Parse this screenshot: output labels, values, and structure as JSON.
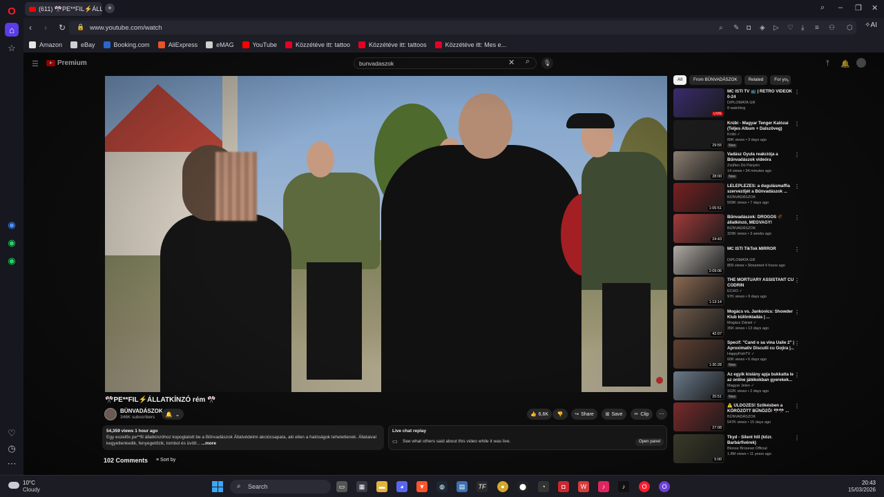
{
  "browser": {
    "tab_title": "(611) 🎌PE**FIL⚡ÁLLATK",
    "url": "www.youtube.com/watch",
    "ai_label": "AI",
    "bookmarks": [
      {
        "label": "Amazon",
        "color": "#e6e6e6"
      },
      {
        "label": "eBay",
        "color": "#cfcfcf"
      },
      {
        "label": "Booking.com",
        "color": "#2a66c9"
      },
      {
        "label": "AliExpress",
        "color": "#e8532a"
      },
      {
        "label": "eMAG",
        "color": "#cfcfcf"
      },
      {
        "label": "YouTube",
        "color": "#ff0000"
      },
      {
        "label": "Közzétéve itt: tattoo",
        "color": "#e60023"
      },
      {
        "label": "Közzétéve itt: tattoos",
        "color": "#e60023"
      },
      {
        "label": "Közzétéve itt: Mes e...",
        "color": "#e60023"
      }
    ]
  },
  "youtube": {
    "logo": "Premium",
    "search_value": "bunvadaszok",
    "video_title": "🎌PE**FIL⚡ÁLLATKÍNZÓ rém 🎌",
    "channel": "BÜNVADÁSZOK",
    "subscribers": "346K subscribers",
    "actions": {
      "likes": "6,6K",
      "share": "Share",
      "save": "Save",
      "clip": "Clip"
    },
    "description": {
      "stats": "54,359 views 1 hour ago",
      "text": "Egy eszelős pe**fil állatkínzóhoz kopogtatott be a Bűnvadászok Állatvédelmi akciócsapata, aki ellen a hatóságok tehetetlenek. Állataival kegyetlenkedik, fenyegetőzik, tombol és üvölt...",
      "more": "...more"
    },
    "live_chat": {
      "title": "Live chat replay",
      "text": "See what others said about this video while it was live.",
      "button": "Open panel"
    },
    "comments_count": "102 Comments",
    "sort_by": "Sort by",
    "chips": [
      "All",
      "From BÜNVADÁSZOK",
      "Related",
      "For yo"
    ],
    "recommendations": [
      {
        "title": "MC ISTI TV 📺 | RETRO VIDEÓK 0-24",
        "channel": "DIPLOMATA GR",
        "meta": "8 watching",
        "badge": "LIVE",
        "thumb": "#3a2c6e",
        "new": false
      },
      {
        "title": "Krúbi - Magyar Tenger Kalózai (Teljes Album + Dalszöveg)",
        "channel": "Krúbi ✓",
        "meta": "89K views • 3 days ago",
        "badge": "29:55",
        "thumb": "#1b1b1b",
        "new": true
      },
      {
        "title": "Vadász Gyula reakciója a Bűnvadászok videóra",
        "channel": "Zsülfen Dó Pányén",
        "meta": "14 views • 34 minutes ago",
        "badge": "28:00",
        "thumb": "#8a7d70",
        "new": true
      },
      {
        "title": "LELEPLEZÉS: a dugulásmaffia szervezőjét a Bűnvadászok ...",
        "channel": "BÜNVADÁSZOK",
        "meta": "509K views • 7 days ago",
        "badge": "1:05:51",
        "thumb": "#7a2020",
        "new": false
      },
      {
        "title": "Bűnvadászok: DROGOS 🥀 állatkínzó, MEGVAGY!",
        "channel": "BÜNVADÁSZOK",
        "meta": "329K views • 3 weeks ago",
        "badge": "24:43",
        "thumb": "#a33a3a",
        "new": false
      },
      {
        "title": "MC ISTI TikTok MIRROR",
        "channel": "DIPLOMATA GR",
        "meta": "809 views • Streamed 4 hours ago",
        "badge": "2:09:06",
        "thumb": "#b0aaa4",
        "new": false
      },
      {
        "title": "THE MORTUARY ASSISTANT CU CODRIN",
        "channel": "ECHO ✓",
        "meta": "97K views • 9 days ago",
        "badge": "1:13:14",
        "thumb": "#8c6a52",
        "new": false
      },
      {
        "title": "Mogács vs. Jankovics: Showder Klub különkiadás | ...",
        "channel": "Mogács Dániel ✓",
        "meta": "35K views • 13 days ago",
        "badge": "42:07",
        "thumb": "#6e5a4a",
        "new": false
      },
      {
        "title": "Specif: \"Cand o sa vina Ualie 2\" | Aproximativ Discutii cu Gojira |...",
        "channel": "HappyFishTV ✓",
        "meta": "60K views • 6 days ago",
        "badge": "1:30:28",
        "thumb": "#5e4030",
        "new": true
      },
      {
        "title": "Az egyik kislány apja bukkatta le az online játékokban gyerekek...",
        "channel": "Magyar Jelen ✓",
        "meta": "162K views • 2 days ago",
        "badge": "20:51",
        "thumb": "#6a7a8a",
        "new": true
      },
      {
        "title": "⚠️ ÜLDÖZÉS! Szökésben a KÖRÖZÖTT BŰNÖZŐ! 🎌🎌 ...",
        "channel": "BÜNVADÁSZOK",
        "meta": "547K views • 15 days ago",
        "badge": "27:08",
        "thumb": "#7a2a2a",
        "new": false
      },
      {
        "title": "Tkyd - Silent hill (közr. Barbárfivérek)",
        "channel": "Bloose Brosewz Official",
        "meta": "1.8M views • 11 years ago",
        "badge": "5:00",
        "thumb": "#3a3a28",
        "new": false
      }
    ]
  },
  "taskbar": {
    "temperature": "10°C",
    "weather": "Cloudy",
    "search_placeholder": "Search",
    "time": "20:43",
    "date": "15/03/2026"
  }
}
